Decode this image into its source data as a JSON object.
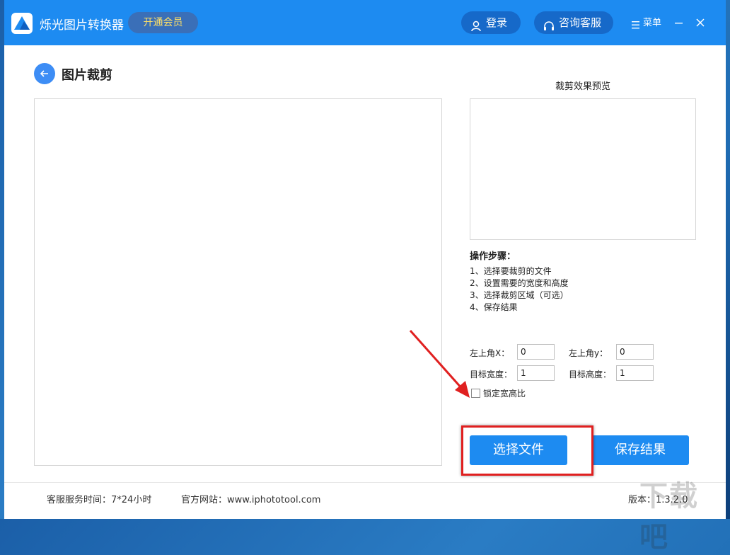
{
  "window": {
    "app_title": "烁光图片转换器",
    "vip_label": "开通会员",
    "login_label": "登录",
    "support_label": "咨询客服",
    "menu_label": "菜单"
  },
  "page": {
    "title": "图片裁剪"
  },
  "preview": {
    "title": "裁剪效果预览"
  },
  "steps": {
    "title": "操作步骤：",
    "items": [
      "1、选择要裁剪的文件",
      "2、设置需要的宽度和高度",
      "3、选择裁剪区域（可选）",
      "4、保存结果"
    ]
  },
  "fields": {
    "top_left_x_label": "左上角X：",
    "top_left_x_value": "0",
    "top_left_y_label": "左上角y：",
    "top_left_y_value": "0",
    "target_width_label": "目标宽度：",
    "target_width_value": "1",
    "target_height_label": "目标高度：",
    "target_height_value": "1",
    "lock_ratio_label": "锁定宽高比",
    "lock_ratio_checked": false
  },
  "actions": {
    "select_file_label": "选择文件",
    "save_result_label": "保存结果"
  },
  "footer": {
    "service_hours": "客服服务时间：7*24小时",
    "website": "官方网站：www.iphototool.com",
    "version": "版本：1.3.2.0"
  },
  "watermark": "下载吧",
  "colors": {
    "accent": "#1d8bf1",
    "titlebar": "#1d8bf1",
    "vip_text": "#ffe066",
    "annotation": "#e02020"
  },
  "icons": [
    "app-logo-icon",
    "user-icon",
    "headset-icon",
    "menu-lines-icon",
    "minimize-icon",
    "close-icon",
    "back-arrow-icon"
  ]
}
